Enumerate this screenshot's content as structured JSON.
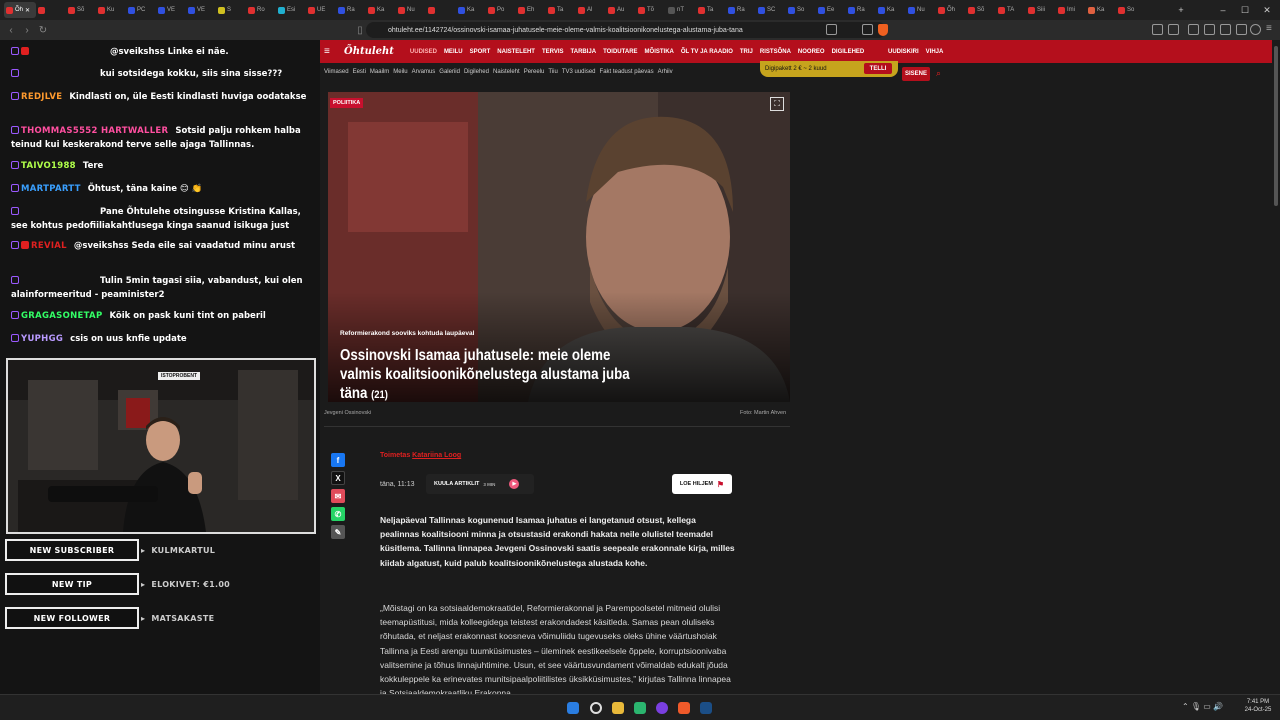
{
  "browser": {
    "tabs": [
      "Õh",
      "",
      "Sõ",
      "Ku",
      "PC",
      "VE",
      "VE",
      "S",
      "Ro",
      "Esi",
      "UE",
      "Ra",
      "Ka",
      "Nu",
      "",
      "Ka",
      "Po",
      "Eh",
      "Ta",
      "Al",
      "Au",
      "Tõ",
      "nT",
      "Ta",
      "Ra",
      "SC",
      "So",
      "Ee",
      "Ra",
      "Ka",
      "Nu",
      "Õh",
      "Sõ",
      "TA",
      "Siii",
      "Imi",
      "Ka",
      "So"
    ],
    "new_tab": "+",
    "minimize": "–",
    "maximize": "☐",
    "close": "✕",
    "url": "ohtuleht.ee/1142724/ossinovski-isamaa-juhatusele-meie-oleme-valmis-koalitsioonikonelustega-alustama-juba-tana"
  },
  "chat": {
    "messages": [
      {
        "user": "",
        "text": "@sveikshss Linke ei näe.",
        "color": "#e02020"
      },
      {
        "user": "",
        "text": "kui sotsidega kokku, siis sina sisse???",
        "color": "#3a3aff"
      },
      {
        "user": "REDJLVE",
        "text": "Kindlasti on, üle Eesti kindlasti huviga oodatakse",
        "color": "#ff9a2e"
      },
      {
        "user": "THOMMAS5552 HARTWALLER",
        "text": "Sotsid palju rohkem halba teinud kui keskerakond terve selle ajaga Tallinnas.",
        "color": "#ff4fa0"
      },
      {
        "user": "TAIVO1988",
        "text": "Tere",
        "color": "#b0ff4a"
      },
      {
        "user": "MARTPARTT",
        "text": "Õhtust, täna kaine 😊 👏",
        "color": "#3aa0ff"
      },
      {
        "user": "",
        "text": "Pane Õhtulehe otsingusse Kristina Kallas, see kohtus pedofiiliakahtlusega kinga saanud isikuga just",
        "color": "#3a3aff"
      },
      {
        "user": "REVIAL",
        "text": "@sveikshss Seda eile sai vaadatud minu arust",
        "color": "#e02020"
      },
      {
        "user": "",
        "text": "Tulin 5min tagasi siia, vabandust, kui olen alainformeeritud - peaminister2",
        "color": "#3a3aff"
      },
      {
        "user": "GRAGASONETAP",
        "text": "Kõik on pask kuni tint on paberil",
        "color": "#33ff66"
      },
      {
        "user": "YUPHGG",
        "text": "csis on uus knfie update",
        "color": "#b99aff"
      }
    ]
  },
  "stream": {
    "cam_sticker": "ISTOPROBENT",
    "alerts": [
      {
        "label": "NEW SUBSCRIBER",
        "value": "KULMKARTUL"
      },
      {
        "label": "NEW TIP",
        "value": "ELOKIVET: €1.00"
      },
      {
        "label": "NEW FOLLOWER",
        "value": "MATSAKASTE"
      }
    ]
  },
  "site": {
    "logo": "Õhtuleht",
    "nav": [
      "UUDISED",
      "MEILU",
      "SPORT",
      "NAISTELEHT",
      "TERVIS",
      "TARBIJA",
      "TOIDUTARE",
      "MÕISTIKA",
      "ÕL TV JA RAADIO",
      "TRIJ",
      "RISTSÕNA",
      "NOOREO",
      "DIGILEHED"
    ],
    "nav_right": [
      "UUDISKIRI",
      "VIHJA"
    ],
    "subnav": [
      "Viimased",
      "Eesti",
      "Maailm",
      "Meilu",
      "Arvamus",
      "Galeriid",
      "Digilehed",
      "Naisteleht",
      "Pereelu",
      "Tiiu",
      "TV3 uudised",
      "Fakt teadust päevas",
      "Arhiiv"
    ],
    "promo": "Digipakett 2 € ~ 2 kuud",
    "promo_button": "TELLI",
    "login": "SISENE",
    "article": {
      "section": "POLIITIKA",
      "kicker": "Reformierakond sooviks kohtuda laupäeval",
      "headline": "Ossinovski Isamaa juhatusele: meie oleme valmis koalitsioonikõnelustega alustama juba täna",
      "comments": "(21)",
      "caption_left": "Jevgeni Ossinovski",
      "caption_right": "Foto: Martin Ahven",
      "author_label": "Toimetas",
      "author": "Katariina Loog",
      "time": "täna, 11:13",
      "listen": "KUULA ARTIKLIT",
      "listen_dur": "3 MIN",
      "read_later": "LOE HILJEM",
      "lead": "Neljapäeval Tallinnas kogunenud Isamaa juhatus ei langetanud otsust, kellega pealinnas koalitsiooni minna ja otsustasid erakondi hakata neile olulistel teemadel küsitlema. Tallinna linnapea Jevgeni Ossinovski saatis seepeale erakonnale kirja, milles kiidab algatust, kuid palub koalitsioonikõnelustega alustada kohe.",
      "body": "„Mõistagi on ka sotsiaaldemokraatidel, Reformierakonnal ja Parempoolsetel mitmeid olulisi teemapüstitusi, mida kolleegidega teistest erakondadest käsitleda. Samas pean oluliseks rõhutada, et neljast erakonnast koosneva võimuliidu tugevuseks oleks ühine väärtushoiak Tallinna ja Eesti arengu tuumküsimustes – üleminek eestikeelsele õppele, korruptsioonivaba valitsemine ja tõhus linnajuhtimine. Usun, et see väärtusvundament võimaldab edukalt jõuda kokkuleppele ka erinevates munitsipaalpoliitilistes üksikküsimustes,” kirjutas Tallinna linnapea ja Sotsiaaldemokraatliku Erakonna"
    }
  },
  "taskbar": {
    "time": "7:41 PM",
    "date": "24-Oct-25"
  }
}
